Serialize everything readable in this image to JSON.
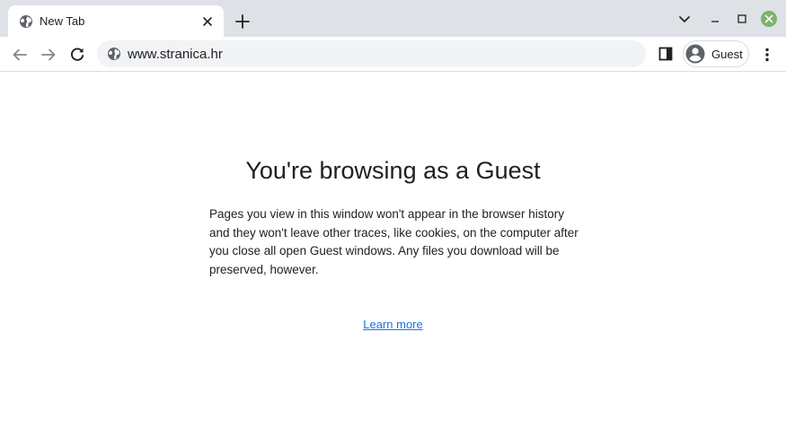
{
  "tab": {
    "title": "New Tab",
    "favicon_icon": "globe-icon",
    "close_icon": "close-icon"
  },
  "tabstrip": {
    "new_tab_icon": "plus-icon",
    "tab_search_icon": "chevron-down-icon",
    "minimize_icon": "minimize-icon",
    "maximize_icon": "maximize-icon",
    "close_window_icon": "close-window-icon",
    "close_window_color": "#7fb26c"
  },
  "toolbar": {
    "back_icon": "arrow-left-icon",
    "forward_icon": "arrow-right-icon",
    "reload_icon": "reload-icon",
    "site_info_icon": "globe-icon",
    "url": "www.stranica.hr",
    "side_panel_icon": "side-panel-icon",
    "profile_icon": "account-circle-icon",
    "profile_label": "Guest",
    "menu_icon": "more-vert-icon"
  },
  "page": {
    "heading": "You're browsing as a Guest",
    "description": "Pages you view in this window won't appear in the browser history and they won't leave other traces, like cookies, on the computer after you close all open Guest windows. Any files you download will be preserved, however.",
    "learn_more": "Learn more",
    "link_color": "#1a73e8"
  }
}
